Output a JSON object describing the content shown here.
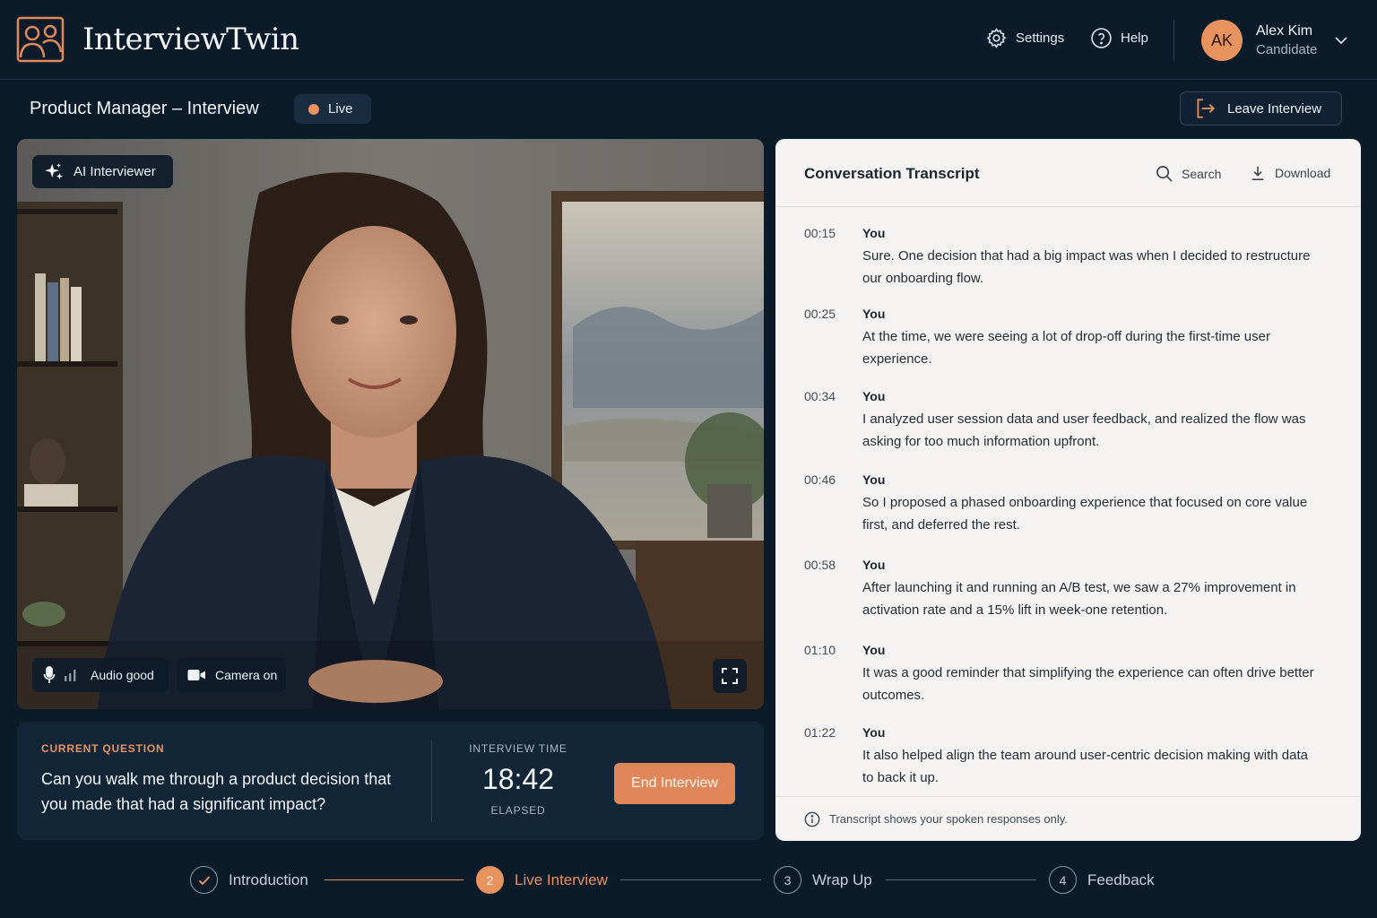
{
  "app": {
    "name": "InterviewTwin",
    "nav": {
      "settings": "Settings",
      "help": "Help"
    },
    "user": {
      "initials": "AK",
      "name": "Alex Kim",
      "role": "Candidate"
    }
  },
  "session": {
    "title": "Product Manager – Interview",
    "status": "Live",
    "leave_label": "Leave Interview"
  },
  "video": {
    "badge": "AI Interviewer",
    "audio_status": "Audio good",
    "camera_status": "Camera on"
  },
  "question": {
    "label": "CURRENT QUESTION",
    "text": "Can you walk me through a product decision that you made that had a significant impact?"
  },
  "timer": {
    "label": "INTERVIEW TIME",
    "value": "18:42",
    "sub": "ELAPSED",
    "end_label": "End Interview"
  },
  "transcript": {
    "title": "Conversation Transcript",
    "search_label": "Search",
    "download_label": "Download",
    "footer": "Transcript shows your spoken responses only.",
    "entries": [
      {
        "time": "00:15",
        "speaker": "You",
        "text": "Sure. One decision that had a big impact was when I decided to restructure our onboarding flow."
      },
      {
        "time": "00:25",
        "speaker": "You",
        "text": "At the time, we were seeing a lot of drop-off during the first-time user experience."
      },
      {
        "time": "00:34",
        "speaker": "You",
        "text": "I analyzed user session data and user feedback, and realized the flow was asking for too much information upfront."
      },
      {
        "time": "00:46",
        "speaker": "You",
        "text": "So I proposed a phased onboarding experience that focused on core value first, and deferred the rest."
      },
      {
        "time": "00:58",
        "speaker": "You",
        "text": "After launching it and running an A/B test, we saw a 27% improvement in activation rate and a 15% lift in week-one retention."
      },
      {
        "time": "01:10",
        "speaker": "You",
        "text": "It was a good reminder that simplifying the experience can often drive better outcomes."
      },
      {
        "time": "01:22",
        "speaker": "You",
        "text": "It also helped align the team around user-centric decision making with data to back it up."
      }
    ]
  },
  "steps": [
    {
      "number": "✓",
      "label": "Introduction",
      "state": "done"
    },
    {
      "number": "2",
      "label": "Live Interview",
      "state": "active"
    },
    {
      "number": "3",
      "label": "Wrap Up",
      "state": "upcoming"
    },
    {
      "number": "4",
      "label": "Feedback",
      "state": "upcoming"
    }
  ],
  "colors": {
    "background": "#0c1b2a",
    "accent": "#e8935e",
    "panel": "#132638",
    "transcript_bg": "#f4f3f1"
  }
}
